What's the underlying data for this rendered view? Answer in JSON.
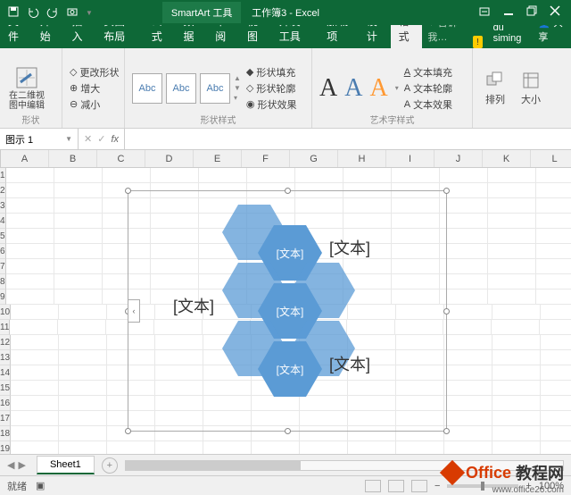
{
  "title": "工作簿3 - Excel",
  "tooltab": "SmartArt 工具",
  "user": "du siming",
  "share": "共享",
  "tellme": "告诉我…",
  "tabs": {
    "file": "文件",
    "home": "开始",
    "insert": "插入",
    "layout": "页面布局",
    "formula": "公式",
    "data": "数据",
    "review": "审阅",
    "view": "视图",
    "dev": "开发工具",
    "addon": "加载项",
    "design": "设计",
    "format": "格式"
  },
  "ribbon": {
    "g1": {
      "edit2d": "在二维视图中编辑",
      "shape": "形状",
      "changeshape": "更改形状",
      "enlarge": "增大",
      "shrink": "减小"
    },
    "g2": {
      "label": "形状样式",
      "abc": "Abc",
      "fill": "形状填充",
      "outline": "形状轮廓",
      "effect": "形状效果"
    },
    "g3": {
      "label": "艺术字样式",
      "tfill": "文本填充",
      "toutline": "文本轮廓",
      "teffect": "文本效果"
    },
    "g4": {
      "arrange": "排列",
      "size": "大小"
    }
  },
  "namebox": "图示 1",
  "columns": [
    "A",
    "B",
    "C",
    "D",
    "E",
    "F",
    "G",
    "H",
    "I",
    "J",
    "K",
    "L"
  ],
  "rows": [
    "1",
    "2",
    "3",
    "4",
    "5",
    "6",
    "7",
    "8",
    "9",
    "10",
    "11",
    "12",
    "13",
    "14",
    "15",
    "16",
    "17",
    "18",
    "19"
  ],
  "smartart": {
    "text": "[文本]"
  },
  "sheet": "Sheet1",
  "addsheet": "+",
  "status": "就绪",
  "zoom": "100%",
  "watermark": {
    "brand1": "Office",
    "brand2": "教程网",
    "url": "www.office26.com"
  }
}
